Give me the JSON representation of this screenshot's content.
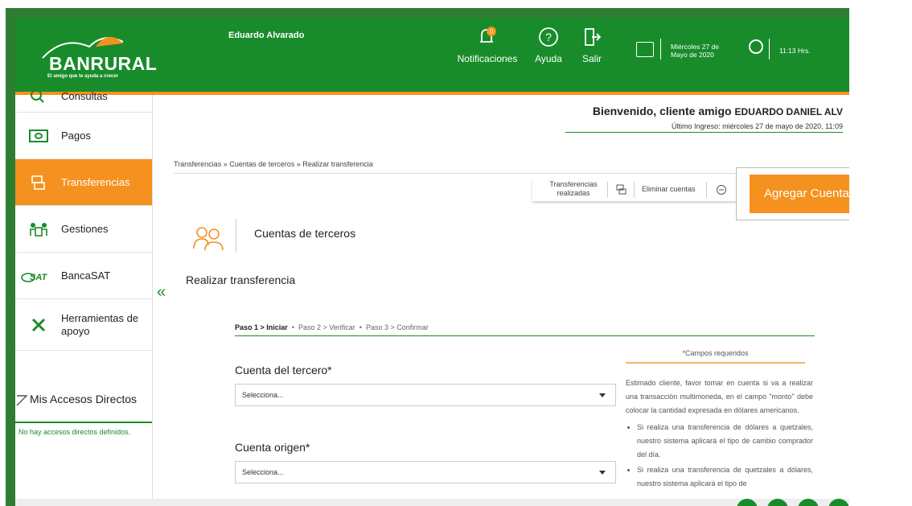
{
  "header": {
    "user_name": "Eduardo Alvarado",
    "logo_text": "BANRURAL",
    "logo_tagline": "El amigo que te ayuda a crecer",
    "notification_count": "0",
    "nav": [
      {
        "label": "Notificaciones",
        "icon": "bell-icon"
      },
      {
        "label": "Ayuda",
        "icon": "help-icon"
      },
      {
        "label": "Salir",
        "icon": "logout-icon"
      }
    ],
    "date": "Miércoles 27 de Mayo de 2020",
    "time": "11:13 Hrs."
  },
  "sidebar": {
    "items": [
      {
        "label": "Consultas",
        "icon": "search-icon"
      },
      {
        "label": "Pagos",
        "icon": "money-icon"
      },
      {
        "label": "Transferencias",
        "icon": "transfer-icon",
        "active": true
      },
      {
        "label": "Gestiones",
        "icon": "people-desk-icon"
      },
      {
        "label": "BancaSAT",
        "icon": "sat-logo-icon"
      },
      {
        "label": "Herramientas de apoyo",
        "icon": "tools-icon"
      }
    ],
    "accesos_title": "Mis Accesos Directos",
    "accesos_empty": "No hay accesos directos definidos."
  },
  "welcome": {
    "greeting": "Bienvenido, cliente amigo",
    "client_name": "EDUARDO DANIEL ALV",
    "last_login": "Último Ingreso: miércoles 27 de mayo de 2020, 11:09"
  },
  "breadcrumb": "Transferencias » Cuentas de terceros » Realizar transferencia",
  "actions": {
    "transfers_done": "Transferencias realizadas",
    "delete_accounts": "Eliminar cuentas",
    "add_account": "Agregar Cuenta"
  },
  "section": {
    "title": "Cuentas de terceros",
    "subtitle": "Realizar transferencia"
  },
  "steps": {
    "step1": "Paso 1 > Iniciar",
    "step2": "Paso 2 > Verificar",
    "step3": "Paso 3 > Confirmar"
  },
  "form": {
    "third_party_label": "Cuenta del tercero*",
    "third_party_value": "Selecciona...",
    "origin_label": "Cuenta origen*",
    "origin_value": "Selecciona..."
  },
  "info": {
    "required": "*Campos requeridos",
    "intro": "Estimado cliente, favor tomar en cuenta si va a realizar una transacción multimoneda, en el campo \"monto\" debe colocar la cantidad expresada en dólares americanos.",
    "bullet1": "Si realiza una transferencia de dólares a quetzales, nuestro sistema aplicará el tipo de cambio comprador del día.",
    "bullet2": "Si realiza una transferencia de quetzales a dólares, nuestro sistema aplicará el tipo de"
  },
  "colors": {
    "brand_green": "#188c2a",
    "accent_orange": "#f5911e"
  }
}
